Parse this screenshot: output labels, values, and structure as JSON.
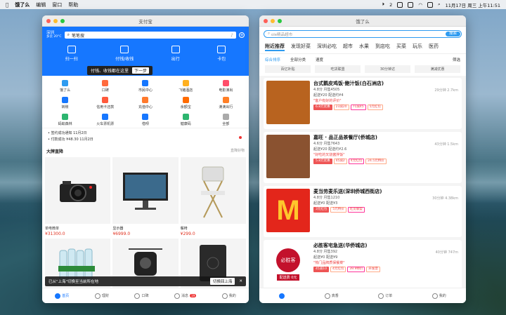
{
  "menubar": {
    "app": "饿了么",
    "items": [
      "编辑",
      "窗口",
      "帮助"
    ],
    "badge": "2",
    "datetime": "11月17日 周三 上午11:51"
  },
  "alipay": {
    "title": "支付宝",
    "city": "深圳",
    "weather": "多云 20°C",
    "search": "笔笔搜",
    "top": [
      {
        "label": "扫一扫"
      },
      {
        "label": "付钱/收钱"
      },
      {
        "label": "出行"
      },
      {
        "label": "卡包"
      }
    ],
    "tip": "付钱、收钱都在这里",
    "tip_next": "下一步",
    "grid": [
      {
        "label": "饿了么",
        "color": "#2e9bf0"
      },
      {
        "label": "口碑",
        "color": "#ff6a3d"
      },
      {
        "label": "市民中心",
        "color": "#1677ff"
      },
      {
        "label": "飞猪酒店",
        "color": "#ffb020"
      },
      {
        "label": "电影演出",
        "color": "#ff4d6a"
      },
      {
        "label": "转账",
        "color": "#1677ff"
      },
      {
        "label": "信用卡还款",
        "color": "#ff5a3c"
      },
      {
        "label": "充值中心",
        "color": "#ff7a2d"
      },
      {
        "label": "余额宝",
        "color": "#ff6b00"
      },
      {
        "label": "滴滴出行",
        "color": "#ff7f27"
      },
      {
        "label": "蚂蚁森林",
        "color": "#2db56f"
      },
      {
        "label": "火车票机票",
        "color": "#1677ff"
      },
      {
        "label": "借呗",
        "color": "#1677ff"
      },
      {
        "label": "健康码",
        "color": "#2db56f"
      },
      {
        "label": "全部",
        "color": "#aaaaaa"
      }
    ],
    "notes": [
      "• 签约成功通知 11月2日",
      "• 付款成功 ¥48.30 11月2日"
    ],
    "section": "大牌直降",
    "section_more": "直降好物",
    "products": [
      {
        "name": "单电微单",
        "price": "¥31300.0"
      },
      {
        "name": "显示器",
        "price": "¥6999.0"
      },
      {
        "name": "餐椅",
        "price": "¥299.0"
      }
    ],
    "toast": "已从\"上海\"切换至当前所在地",
    "toast_btn": "切换回上海",
    "tabs": [
      "首页",
      "理财",
      "口碑",
      "消息",
      "我的"
    ],
    "msg_count": "19"
  },
  "eleme": {
    "title": "饿了么",
    "search": "ole精品超市",
    "search_btn": "搜索",
    "cats": [
      "附近推荐",
      "发现好菜",
      "深圳必吃",
      "超市",
      "水果",
      "到店吃",
      "买菜",
      "玩乐",
      "医药"
    ],
    "filters": [
      "综合排序",
      "全部分类",
      "速度",
      "筛选"
    ],
    "chips": [
      "百亿补贴",
      "吃货联盟",
      "30分钟达",
      "满减优惠"
    ],
    "shops": [
      {
        "name": "台式鹅皮鸡饭·鲍汁饭(白石洲店)",
        "meta": "4.8分 月售4505",
        "fee": "起送¥20 配送约¥4",
        "promo": "\"客户有好的评价\"",
        "tags": [
          "6.8元优惠",
          "23减20",
          "71减45",
          "5元红包"
        ],
        "dist": "29分钟 2.7km",
        "img": "#b8631f"
      },
      {
        "name": "嘉旺 · 品正品茶餐厅(侨城店)",
        "meta": "4.6分 月售7643",
        "fee": "起送¥20 配送约¥2.6",
        "promo": "\"好吃的叉烧酱拌饭\"",
        "tags": [
          "5.8元优惠",
          "45减2",
          "4元红包",
          "24.5元特价"
        ],
        "dist": "43分钟 1.5km",
        "img": "#8a5230"
      },
      {
        "name": "麦当劳麦乐送(深圳侨城西街店)",
        "meta": "4.8分 月售1210",
        "fee": "起送¥0 配送¥3",
        "promo": "",
        "tags": [
          "3元红包",
          "5元特价",
          "吃货联盟"
        ],
        "dist": "30分钟 4.38km",
        "img": "#e3261b"
      },
      {
        "name": "必胜客宅急送(华侨城店)",
        "meta": "4.8分 月售392",
        "fee": "起送¥0 配送¥9",
        "promo": "\"热门品牌质保餐菜\"",
        "tags": [
          "45减10",
          "4元红包",
          "39.9特价",
          "开发票"
        ],
        "dist": "40分钟 747m",
        "img": "#c3112c"
      }
    ],
    "mcd": "M",
    "phut": "必胜客",
    "phut_fee": "配送费 0元",
    "tabs": [
      "",
      "真香",
      "订单",
      "我的"
    ]
  }
}
